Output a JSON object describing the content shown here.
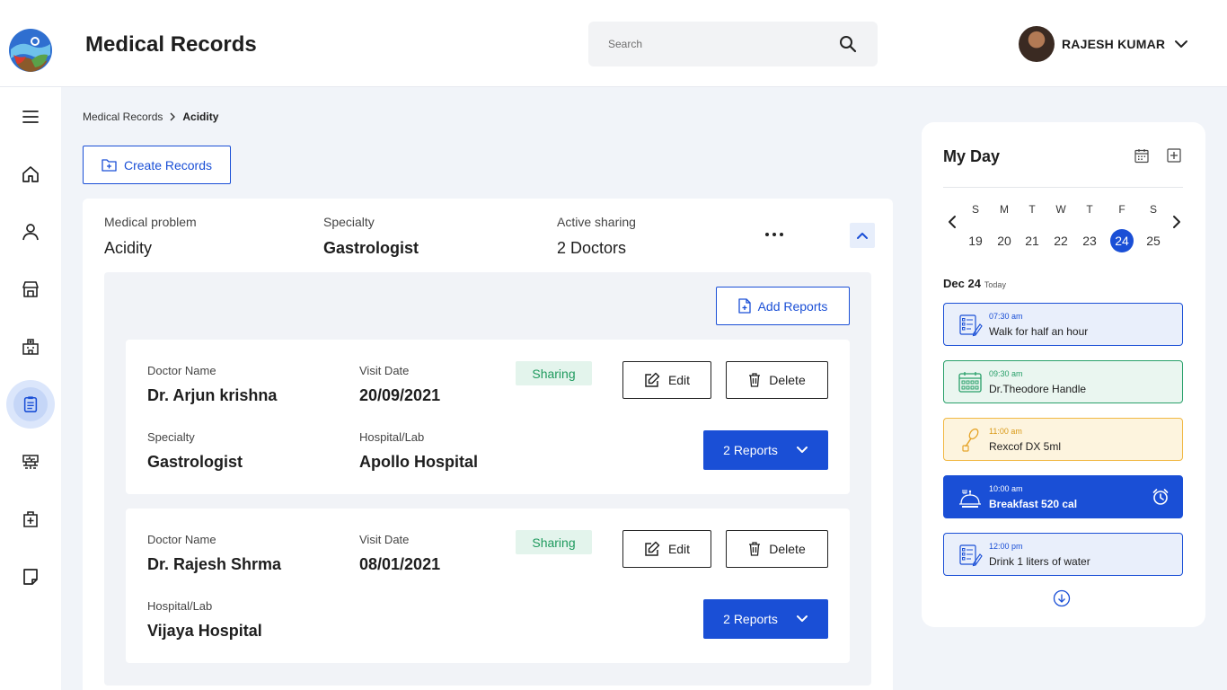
{
  "header": {
    "title": "Medical Records",
    "search_placeholder": "Search",
    "user_name": "RAJESH KUMAR"
  },
  "sidebar": {
    "items": [
      {
        "name": "menu-icon"
      },
      {
        "name": "home-icon"
      },
      {
        "name": "profile-icon"
      },
      {
        "name": "store-icon"
      },
      {
        "name": "hospital-icon"
      },
      {
        "name": "medical-records-icon",
        "active": true
      },
      {
        "name": "diagnostics-icon"
      },
      {
        "name": "health-kit-icon"
      },
      {
        "name": "notes-icon"
      }
    ]
  },
  "breadcrumb": {
    "root": "Medical Records",
    "current": "Acidity"
  },
  "actions": {
    "create_label": "Create Records",
    "add_reports_label": "Add Reports"
  },
  "problem": {
    "problem_label": "Medical problem",
    "problem_value": "Acidity",
    "specialty_label": "Specialty",
    "specialty_value": "Gastrologist",
    "sharing_label": "Active sharing",
    "sharing_value": "2 Doctors"
  },
  "records": [
    {
      "doctor_label": "Doctor Name",
      "doctor": "Dr. Arjun krishna",
      "visit_label": "Visit Date",
      "visit_date": "20/09/2021",
      "status": "Sharing",
      "edit_label": "Edit",
      "delete_label": "Delete",
      "specialty_label": "Specialty",
      "specialty": "Gastrologist",
      "hospital_label": "Hospital/Lab",
      "hospital": "Apollo Hospital",
      "reports_label": "2 Reports"
    },
    {
      "doctor_label": "Doctor Name",
      "doctor": "Dr. Rajesh Shrma",
      "visit_label": "Visit Date",
      "visit_date": "08/01/2021",
      "status": "Sharing",
      "edit_label": "Edit",
      "delete_label": "Delete",
      "hospital_label": "Hospital/Lab",
      "hospital": "Vijaya Hospital",
      "reports_label": "2 Reports"
    }
  ],
  "my_day": {
    "title": "My Day",
    "week": [
      {
        "letter": "S",
        "num": "19"
      },
      {
        "letter": "M",
        "num": "20"
      },
      {
        "letter": "T",
        "num": "21"
      },
      {
        "letter": "W",
        "num": "22"
      },
      {
        "letter": "T",
        "num": "23"
      },
      {
        "letter": "F",
        "num": "24",
        "selected": true
      },
      {
        "letter": "S",
        "num": "25"
      }
    ],
    "date": "Dec 24",
    "today_label": "Today",
    "events": [
      {
        "time": "07:30 am",
        "text": "Walk for half an hour",
        "style": "blue",
        "icon": "checklist-icon"
      },
      {
        "time": "09:30 am",
        "text": "Dr.Theodore Handle",
        "style": "green",
        "icon": "calendar-icon"
      },
      {
        "time": "11:00 am",
        "text": "Rexcof DX 5ml",
        "style": "yellow",
        "icon": "medicine-spoon-icon"
      },
      {
        "time": "10:00 am",
        "text": "Breakfast 520 cal",
        "style": "solid",
        "icon": "food-icon"
      },
      {
        "time": "12:00 pm",
        "text": "Drink 1 liters of water",
        "style": "blue",
        "icon": "checklist-icon"
      }
    ]
  },
  "colors": {
    "primary": "#1a4fd6",
    "sharing_bg": "#e3f4ec",
    "sharing_text": "#1f9a5e",
    "page_bg": "#f1f4f9"
  }
}
